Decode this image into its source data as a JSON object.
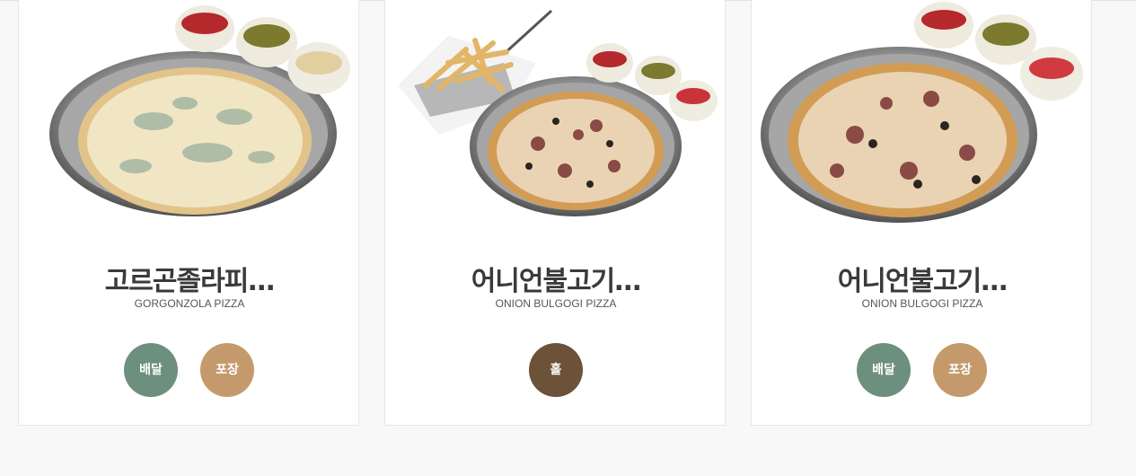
{
  "colors": {
    "delivery": "#6d8f7e",
    "takeout": "#c49a6c",
    "hall": "#6b5238"
  },
  "menu": [
    {
      "name": "고르곤졸라피…",
      "english": "GORGONZOLA PIZZA",
      "image": "gorgonzola-pizza-with-dipping-sauces",
      "buttons": [
        "배달",
        "포장"
      ]
    },
    {
      "name": "어니언불고기…",
      "english": "ONION BULGOGI PIZZA",
      "image": "onion-bulgogi-pizza-with-fries-basket",
      "buttons": [
        "홀"
      ]
    },
    {
      "name": "어니언불고기…",
      "english": "ONION BULGOGI PIZZA",
      "image": "onion-bulgogi-pizza-with-dipping-sauces",
      "buttons": [
        "배달",
        "포장"
      ]
    }
  ]
}
